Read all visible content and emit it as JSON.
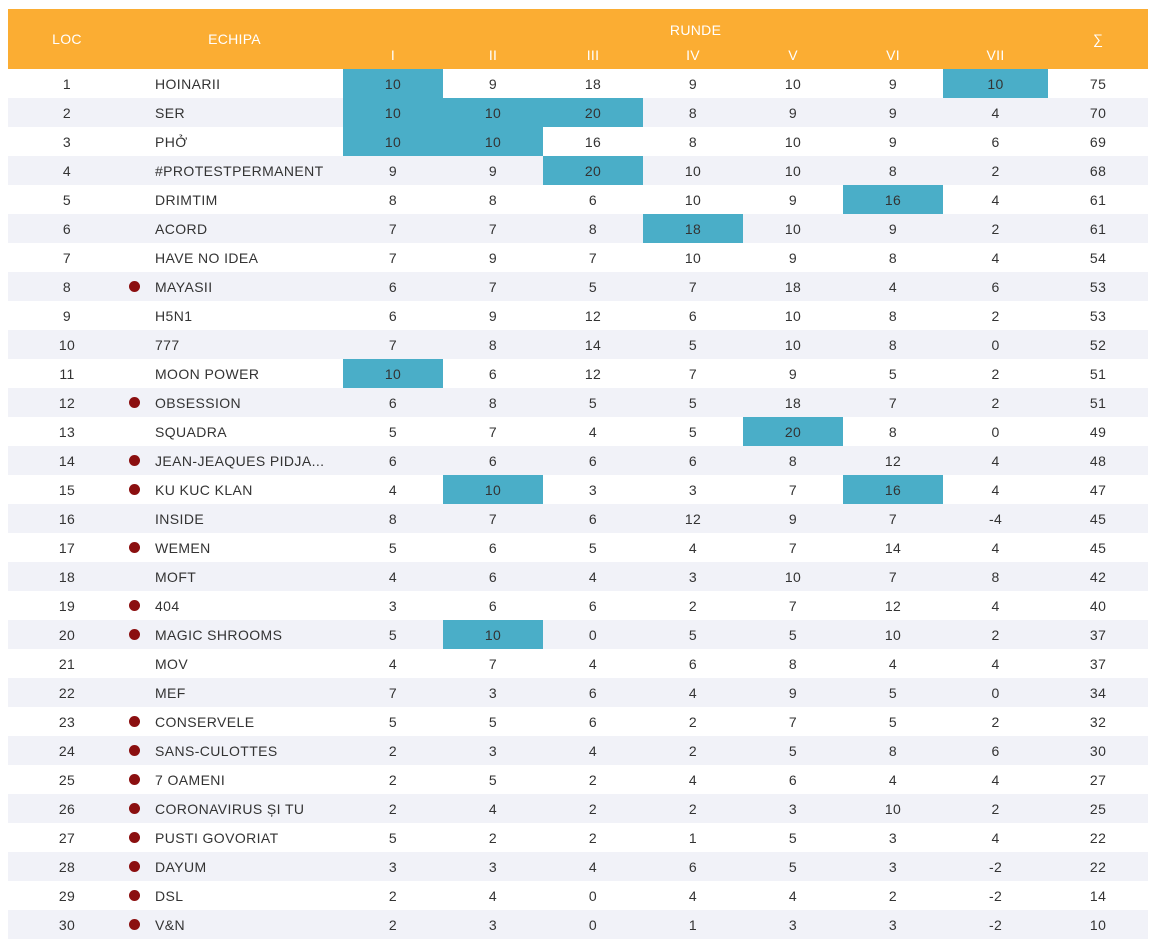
{
  "header": {
    "loc": "LOC",
    "team": "ECHIPA",
    "runde": "RUNDE",
    "rounds": [
      "I",
      "II",
      "III",
      "IV",
      "V",
      "VI",
      "VII"
    ],
    "sum": "∑"
  },
  "colors": {
    "header_bg": "#fbad33",
    "highlight": "#4aaec8",
    "marker": "#8b0f10"
  },
  "rows": [
    {
      "pos": "1",
      "team": "HOINARII",
      "marker": false,
      "scores": [
        "10",
        "9",
        "18",
        "9",
        "10",
        "9",
        "10"
      ],
      "total": "75",
      "highlight": [
        0,
        6
      ]
    },
    {
      "pos": "2",
      "team": "SER",
      "marker": false,
      "scores": [
        "10",
        "10",
        "20",
        "8",
        "9",
        "9",
        "4"
      ],
      "total": "70",
      "highlight": [
        0,
        1,
        2
      ]
    },
    {
      "pos": "3",
      "team": "PHỞ",
      "marker": false,
      "scores": [
        "10",
        "10",
        "16",
        "8",
        "10",
        "9",
        "6"
      ],
      "total": "69",
      "highlight": [
        0,
        1
      ]
    },
    {
      "pos": "4",
      "team": "#PROTESTPERMANENT",
      "marker": false,
      "scores": [
        "9",
        "9",
        "20",
        "10",
        "10",
        "8",
        "2"
      ],
      "total": "68",
      "highlight": [
        2
      ]
    },
    {
      "pos": "5",
      "team": "DRIMTIM",
      "marker": false,
      "scores": [
        "8",
        "8",
        "6",
        "10",
        "9",
        "16",
        "4"
      ],
      "total": "61",
      "highlight": [
        5
      ]
    },
    {
      "pos": "6",
      "team": "ACORD",
      "marker": false,
      "scores": [
        "7",
        "7",
        "8",
        "18",
        "10",
        "9",
        "2"
      ],
      "total": "61",
      "highlight": [
        3
      ]
    },
    {
      "pos": "7",
      "team": "HAVE NO IDEA",
      "marker": false,
      "scores": [
        "7",
        "9",
        "7",
        "10",
        "9",
        "8",
        "4"
      ],
      "total": "54",
      "highlight": []
    },
    {
      "pos": "8",
      "team": "MAYASII",
      "marker": true,
      "scores": [
        "6",
        "7",
        "5",
        "7",
        "18",
        "4",
        "6"
      ],
      "total": "53",
      "highlight": []
    },
    {
      "pos": "9",
      "team": "H5N1",
      "marker": false,
      "scores": [
        "6",
        "9",
        "12",
        "6",
        "10",
        "8",
        "2"
      ],
      "total": "53",
      "highlight": []
    },
    {
      "pos": "10",
      "team": "777",
      "marker": false,
      "scores": [
        "7",
        "8",
        "14",
        "5",
        "10",
        "8",
        "0"
      ],
      "total": "52",
      "highlight": []
    },
    {
      "pos": "11",
      "team": "MOON POWER",
      "marker": false,
      "scores": [
        "10",
        "6",
        "12",
        "7",
        "9",
        "5",
        "2"
      ],
      "total": "51",
      "highlight": [
        0
      ]
    },
    {
      "pos": "12",
      "team": "OBSESSION",
      "marker": true,
      "scores": [
        "6",
        "8",
        "5",
        "5",
        "18",
        "7",
        "2"
      ],
      "total": "51",
      "highlight": []
    },
    {
      "pos": "13",
      "team": "SQUADRA",
      "marker": false,
      "scores": [
        "5",
        "7",
        "4",
        "5",
        "20",
        "8",
        "0"
      ],
      "total": "49",
      "highlight": [
        4
      ]
    },
    {
      "pos": "14",
      "team": "JEAN-JEAQUES PIDJA...",
      "marker": true,
      "scores": [
        "6",
        "6",
        "6",
        "6",
        "8",
        "12",
        "4"
      ],
      "total": "48",
      "highlight": []
    },
    {
      "pos": "15",
      "team": "KU KUC KLAN",
      "marker": true,
      "scores": [
        "4",
        "10",
        "3",
        "3",
        "7",
        "16",
        "4"
      ],
      "total": "47",
      "highlight": [
        1,
        5
      ]
    },
    {
      "pos": "16",
      "team": "INSIDE",
      "marker": false,
      "scores": [
        "8",
        "7",
        "6",
        "12",
        "9",
        "7",
        "-4"
      ],
      "total": "45",
      "highlight": []
    },
    {
      "pos": "17",
      "team": "WEMEN",
      "marker": true,
      "scores": [
        "5",
        "6",
        "5",
        "4",
        "7",
        "14",
        "4"
      ],
      "total": "45",
      "highlight": []
    },
    {
      "pos": "18",
      "team": "MOFT",
      "marker": false,
      "scores": [
        "4",
        "6",
        "4",
        "3",
        "10",
        "7",
        "8"
      ],
      "total": "42",
      "highlight": []
    },
    {
      "pos": "19",
      "team": "404",
      "marker": true,
      "scores": [
        "3",
        "6",
        "6",
        "2",
        "7",
        "12",
        "4"
      ],
      "total": "40",
      "highlight": []
    },
    {
      "pos": "20",
      "team": "MAGIC SHROOMS",
      "marker": true,
      "scores": [
        "5",
        "10",
        "0",
        "5",
        "5",
        "10",
        "2"
      ],
      "total": "37",
      "highlight": [
        1
      ]
    },
    {
      "pos": "21",
      "team": "MOV",
      "marker": false,
      "scores": [
        "4",
        "7",
        "4",
        "6",
        "8",
        "4",
        "4"
      ],
      "total": "37",
      "highlight": []
    },
    {
      "pos": "22",
      "team": "MEF",
      "marker": false,
      "scores": [
        "7",
        "3",
        "6",
        "4",
        "9",
        "5",
        "0"
      ],
      "total": "34",
      "highlight": []
    },
    {
      "pos": "23",
      "team": "CONSERVELE",
      "marker": true,
      "scores": [
        "5",
        "5",
        "6",
        "2",
        "7",
        "5",
        "2"
      ],
      "total": "32",
      "highlight": []
    },
    {
      "pos": "24",
      "team": "SANS-CULOTTES",
      "marker": true,
      "scores": [
        "2",
        "3",
        "4",
        "2",
        "5",
        "8",
        "6"
      ],
      "total": "30",
      "highlight": []
    },
    {
      "pos": "25",
      "team": "7 OAMENI",
      "marker": true,
      "scores": [
        "2",
        "5",
        "2",
        "4",
        "6",
        "4",
        "4"
      ],
      "total": "27",
      "highlight": []
    },
    {
      "pos": "26",
      "team": "CORONAVIRUS ȘI TU",
      "marker": true,
      "scores": [
        "2",
        "4",
        "2",
        "2",
        "3",
        "10",
        "2"
      ],
      "total": "25",
      "highlight": []
    },
    {
      "pos": "27",
      "team": "PUSTI GOVORIAT",
      "marker": true,
      "scores": [
        "5",
        "2",
        "2",
        "1",
        "5",
        "3",
        "4"
      ],
      "total": "22",
      "highlight": []
    },
    {
      "pos": "28",
      "team": "DAYUM",
      "marker": true,
      "scores": [
        "3",
        "3",
        "4",
        "6",
        "5",
        "3",
        "-2"
      ],
      "total": "22",
      "highlight": []
    },
    {
      "pos": "29",
      "team": "DSL",
      "marker": true,
      "scores": [
        "2",
        "4",
        "0",
        "4",
        "4",
        "2",
        "-2"
      ],
      "total": "14",
      "highlight": []
    },
    {
      "pos": "30",
      "team": "V&N",
      "marker": true,
      "scores": [
        "2",
        "3",
        "0",
        "1",
        "3",
        "3",
        "-2"
      ],
      "total": "10",
      "highlight": []
    }
  ]
}
